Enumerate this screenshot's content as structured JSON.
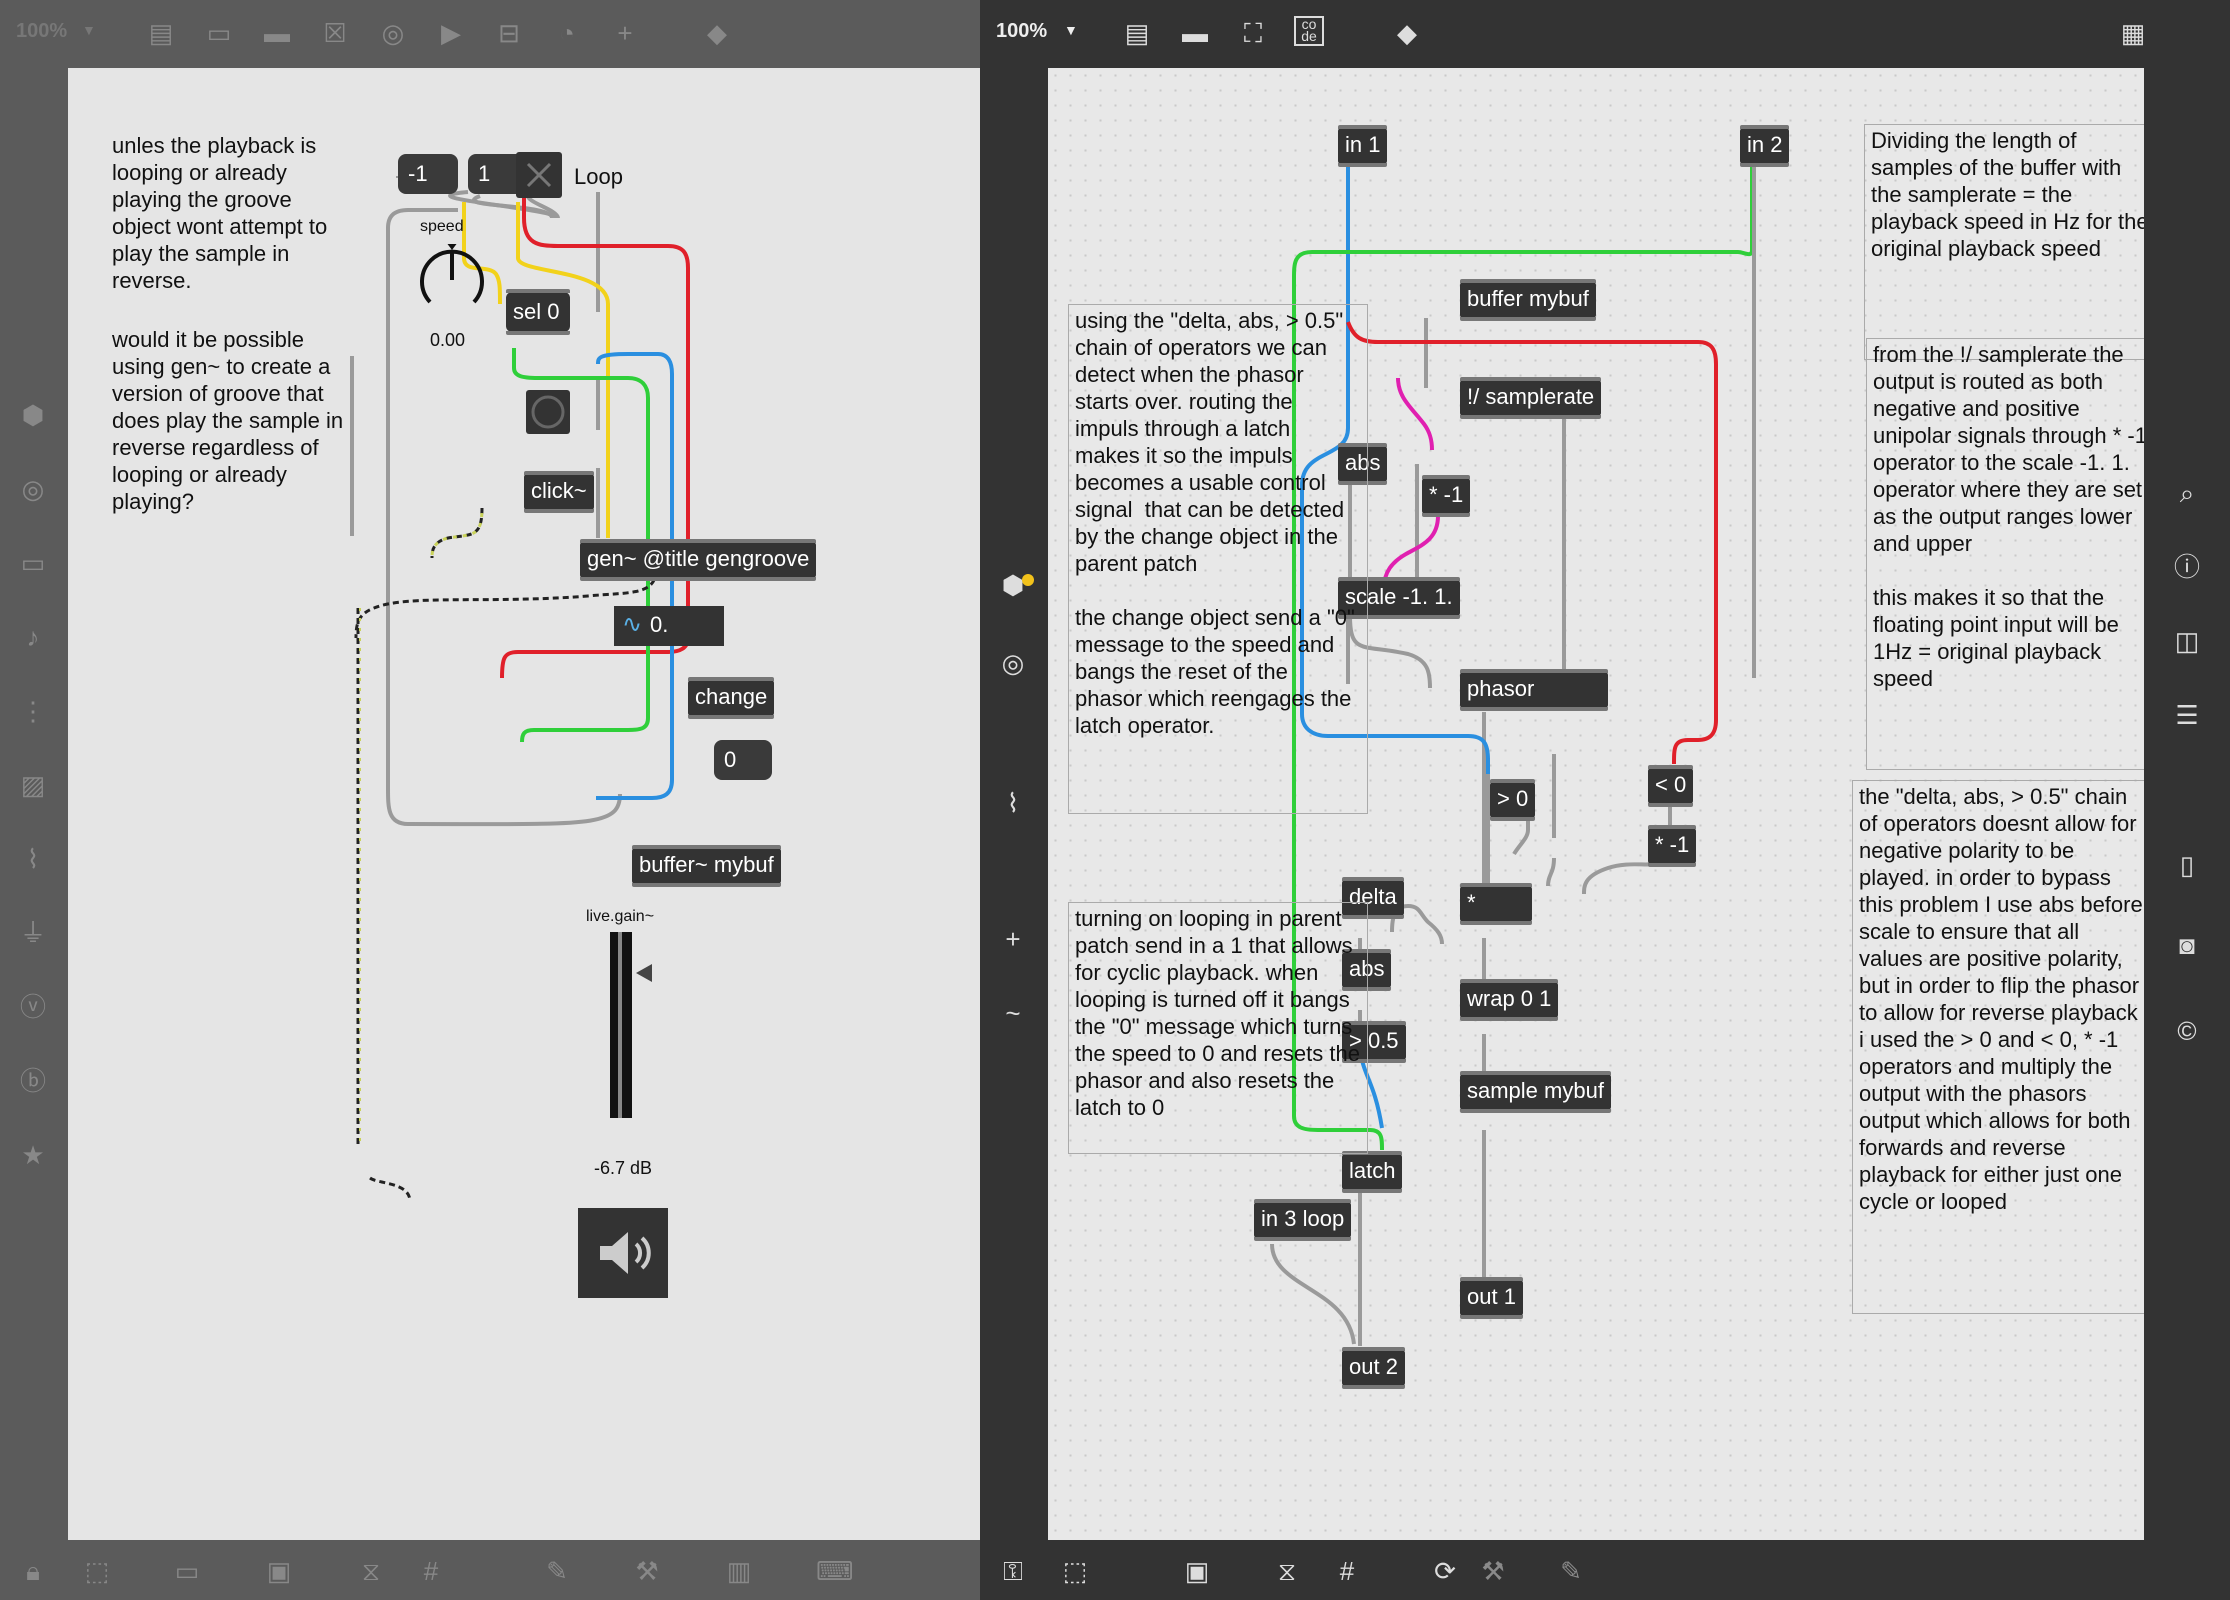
{
  "left": {
    "zoom": "100%",
    "comments": {
      "c1": "unles the playback is looping or already playing the groove object wont attempt to play the sample in reverse.",
      "c2": "would it be possible using gen~ to create a version of groove that does play the sample in reverse regardless of looping or already playing?"
    },
    "objects": {
      "msg_neg1": "-1",
      "msg_1": "1",
      "toggle_label": "Loop",
      "dial_label": "speed",
      "dial_value": "0.00",
      "sel": "sel 0",
      "click": "click~",
      "gen": "gen~ @title gengroove",
      "number": "0.",
      "change": "change",
      "msg_0": "0",
      "buffer": "buffer~ mybuf",
      "gain_label": "live.gain~",
      "gain_value": "-6.7 dB"
    }
  },
  "right": {
    "zoom": "100%",
    "objects": {
      "in1": "in 1",
      "in2": "in 2",
      "buffer": "buffer mybuf",
      "samplerate": "!/ samplerate",
      "abs1": "abs",
      "mul_neg1": "* -1",
      "scale": "scale -1. 1.",
      "phasor": "phasor",
      "gt0": "> 0",
      "lt0": "< 0",
      "mul_neg1b": "* -1",
      "mul": "*",
      "delta": "delta",
      "abs2": "abs",
      "gt05": "> 0.5",
      "wrap": "wrap 0 1",
      "sample": "sample mybuf",
      "latch": "latch",
      "in3": "in 3 loop",
      "out1": "out 1",
      "out2": "out 2"
    },
    "comments": {
      "c1": "Dividing the length of samples of the buffer with the samplerate = the playback speed in Hz for the original playback speed",
      "c2": "from the !/ samplerate the output is routed as both negative and positive unipolar signals through * -1 operator to the scale -1. 1. operator where they are set as the output ranges lower and upper\n\nthis makes it so that the floating point input will be 1Hz = original playback speed",
      "c3": "using the \"delta, abs, > 0.5\" chain of operators we can detect when the phasor starts over. routing the impuls through a latch makes it so the impuls becomes a usable control signal  that can be detected by the change object in the parent patch\n\nthe change object send a \"0\" message to the speed and bangs the reset of the phasor which reengages the latch operator.",
      "c4": "turning on looping in parent patch send in a 1 that allows for cyclic playback. when looping is turned off it bangs the \"0\" message which turns the speed to 0 and resets the phasor and also resets the latch to 0",
      "c5": "the \"delta, abs, > 0.5\" chain of operators doesnt allow for negative polarity to be played. in order to bypass this problem I use abs before scale to ensure that all values are positive polarity, but in order to flip the phasor to allow for reverse playback i used the > 0 and < 0, * -1 operators and multiply the output with the phasors output which allows for both forwards and reverse playback for either just one cycle or looped"
    }
  },
  "colors": {
    "yellow": "#f2d21b",
    "red": "#e0202a",
    "blue": "#2a8fe0",
    "green": "#2fcf3a",
    "magenta": "#e020b0",
    "gray": "#9a9a9a"
  }
}
